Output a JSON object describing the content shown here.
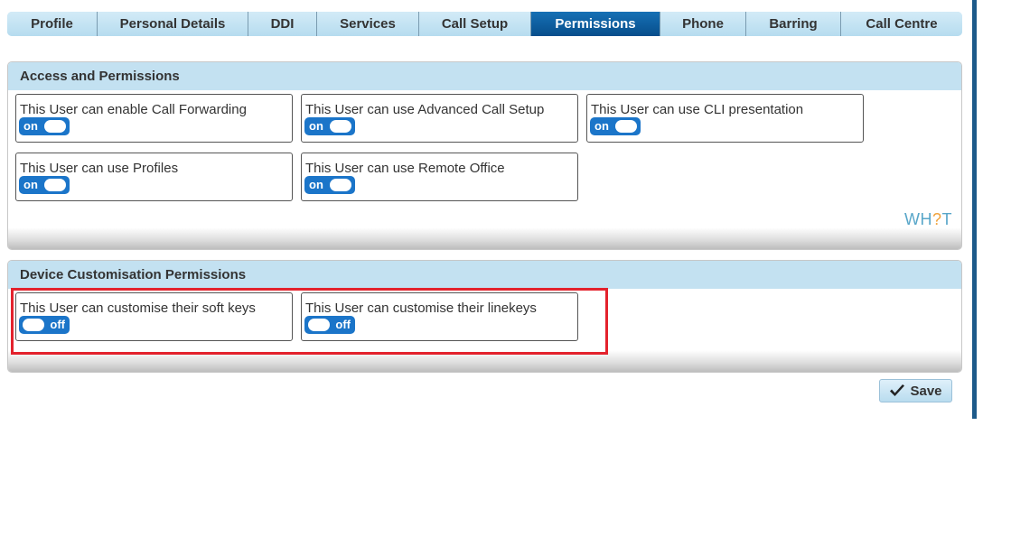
{
  "tabs": [
    {
      "label": "Profile",
      "active": false
    },
    {
      "label": "Personal Details",
      "active": false
    },
    {
      "label": "DDI",
      "active": false
    },
    {
      "label": "Services",
      "active": false
    },
    {
      "label": "Call Setup",
      "active": false
    },
    {
      "label": "Permissions",
      "active": true
    },
    {
      "label": "Phone",
      "active": false
    },
    {
      "label": "Barring",
      "active": false
    },
    {
      "label": "Call Centre",
      "active": false
    }
  ],
  "access": {
    "title": "Access and Permissions",
    "items": [
      {
        "label": "This User can enable Call Forwarding",
        "state": "on"
      },
      {
        "label": "This User can use Advanced Call Setup",
        "state": "on"
      },
      {
        "label": "This User can use CLI presentation",
        "state": "on"
      },
      {
        "label": "This User can use Profiles",
        "state": "on"
      },
      {
        "label": "This User can use Remote Office",
        "state": "on"
      }
    ]
  },
  "device": {
    "title": "Device Customisation Permissions",
    "items": [
      {
        "label": "This User can customise their soft keys",
        "state": "off"
      },
      {
        "label": "This User can customise their linekeys",
        "state": "off"
      }
    ]
  },
  "logo": {
    "part1": "WH",
    "mark": "?",
    "part2": "T"
  },
  "save": {
    "label": "Save",
    "icon": "checkmark-icon"
  },
  "colors": {
    "accent": "#1b75c9",
    "active_tab": "#0b5b9c",
    "header": "#c3e1f1",
    "highlight": "#e3222d"
  }
}
